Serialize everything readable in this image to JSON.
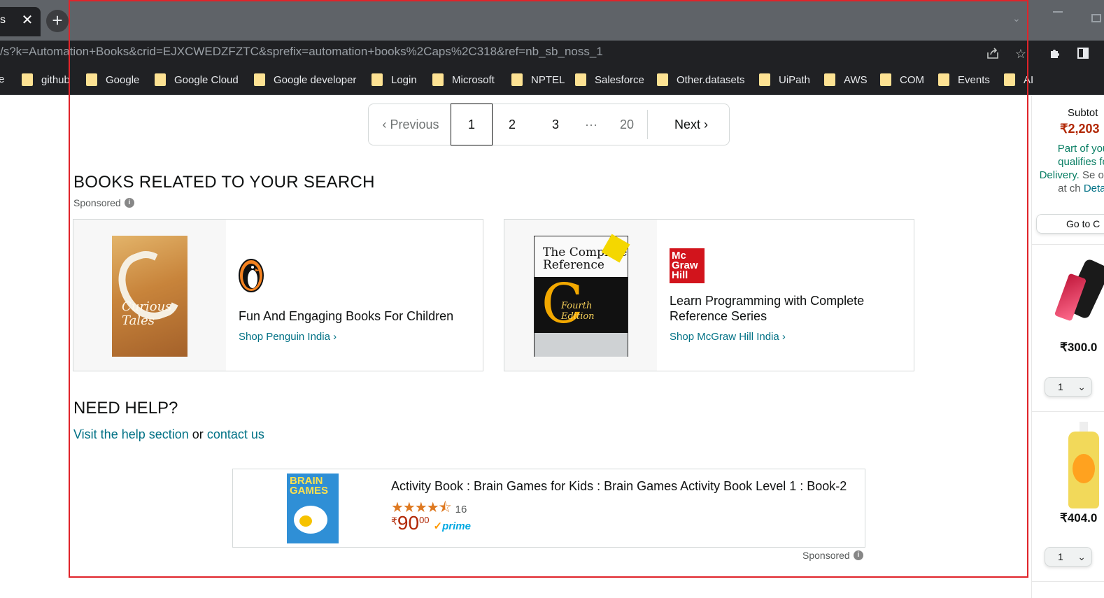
{
  "browser": {
    "tab_fragment": "s",
    "tab_close": "✕",
    "new_tab": "+",
    "url": "/s?k=Automation+Books&crid=EJXCWEDZFZTC&sprefix=automation+books%2Caps%2C318&ref=nb_sb_noss_1",
    "bookmarks": [
      {
        "label": "e",
        "icon": "folder-icon"
      },
      {
        "label": "github",
        "icon": "folder-icon"
      },
      {
        "label": "Google",
        "icon": "folder-icon"
      },
      {
        "label": "Google Cloud",
        "icon": "folder-icon"
      },
      {
        "label": "Google developer",
        "icon": "folder-icon"
      },
      {
        "label": "Login",
        "icon": "folder-icon"
      },
      {
        "label": "Microsoft",
        "icon": "folder-icon"
      },
      {
        "label": "NPTEL",
        "icon": "folder-icon"
      },
      {
        "label": "Salesforce",
        "icon": "folder-icon"
      },
      {
        "label": "Other.datasets",
        "icon": "folder-icon"
      },
      {
        "label": "UiPath",
        "icon": "folder-icon"
      },
      {
        "label": "AWS",
        "icon": "folder-icon"
      },
      {
        "label": "COM",
        "icon": "folder-icon"
      },
      {
        "label": "Events",
        "icon": "folder-icon"
      },
      {
        "label": "AI",
        "icon": "folder-icon"
      }
    ]
  },
  "pagination": {
    "previous": "Previous",
    "pages": [
      "1",
      "2",
      "3",
      "20"
    ],
    "ellipsis": "···",
    "current": "1",
    "next": "Next"
  },
  "related": {
    "title": "BOOKS RELATED TO YOUR SEARCH",
    "sponsored": "Sponsored",
    "cards": [
      {
        "headline": "Fun And Engaging Books For Children",
        "link": "Shop Penguin India ›",
        "book_title": "Curious Tales"
      },
      {
        "headline": "Learn Programming with Complete Reference Series",
        "link": "Shop McGraw Hill India ›",
        "book_title": "The Complete Reference",
        "book_letter": "C",
        "book_edition": "Fourth Edition",
        "logo_lines": [
          "Mc",
          "Graw",
          "Hill"
        ]
      }
    ]
  },
  "help": {
    "title": "NEED HELP?",
    "visit_link": "Visit the help section",
    "or": "or",
    "contact_link": "contact us"
  },
  "bottom_ad": {
    "title": "Activity Book : Brain Games for Kids : Brain Games Activity Book Level 1 : Book-2",
    "rating_stars": 4.5,
    "rating_count": "16",
    "price_symbol": "₹",
    "price_whole": "90",
    "price_fraction": "00",
    "prime": "prime",
    "sponsored": "Sponsored",
    "book_cover_text": "BRAIN GAMES"
  },
  "cart": {
    "subtotal_label": "Subtot",
    "subtotal_value": "₹2,203",
    "free_delivery_green": "Part of you qualifies fo",
    "free_delivery_bold": "Delivery.",
    "free_delivery_tail": "Se option at ch",
    "details_link": "Detai",
    "go_to_cart": "Go to C",
    "items": [
      {
        "price": "₹300.0",
        "qty": "1"
      },
      {
        "price": "₹404.0",
        "qty": "1"
      }
    ]
  },
  "colors": {
    "link": "#007185",
    "price": "#b12704",
    "highlight_border": "#e0242a",
    "star": "#de7921"
  }
}
